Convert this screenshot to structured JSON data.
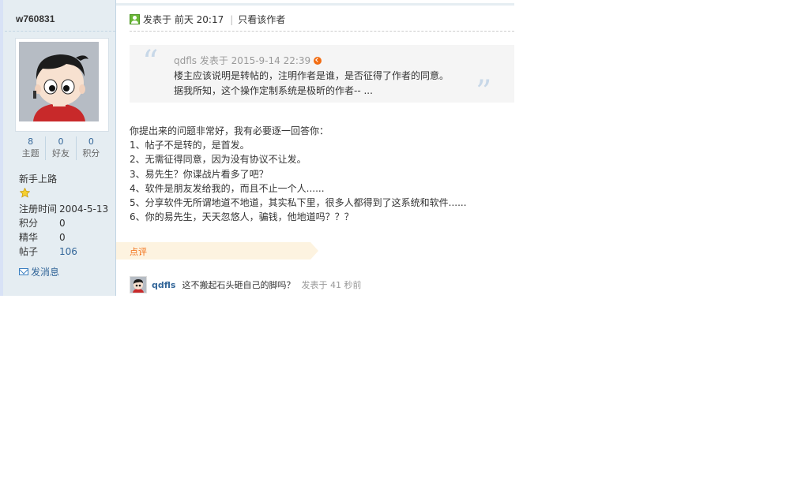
{
  "user": {
    "username": "w760831",
    "stats": [
      {
        "value": "8",
        "label": "主题"
      },
      {
        "value": "0",
        "label": "好友"
      },
      {
        "value": "0",
        "label": "积分"
      }
    ],
    "rank": "新手上路",
    "info": [
      {
        "key": "注册时间",
        "value": "2004-5-13"
      },
      {
        "key": "积分",
        "value": "0"
      },
      {
        "key": "精华",
        "value": "0"
      },
      {
        "key": "帖子",
        "value": "106"
      }
    ],
    "message_link": "发消息"
  },
  "post": {
    "posted_label": "发表于 前天 20:17",
    "only_author": "只看该作者",
    "quote": {
      "open_mark": "“",
      "close_mark": "”",
      "header": "qdfls 发表于 2015-9-14 22:39",
      "lines": [
        "楼主应该说明是转帖的，注明作者是谁，是否征得了作者的同意。",
        "据我所知，这个操作定制系统是极昕的作者-- ..."
      ]
    },
    "body_lines": [
      "你提出来的问题非常好，我有必要逐一回答你：",
      "1、帖子不是转的，是首发。",
      "2、无需征得同意，因为没有协议不让发。",
      "3、易先生？你谍战片看多了吧？",
      "4、软件是朋友发给我的，而且不止一个人......",
      "5、分享软件无所谓地道不地道，其实私下里，很多人都得到了这系统和软件......",
      "6、你的易先生，天天忽悠人，骗钱，他地道吗？？？"
    ]
  },
  "review": {
    "label": "点评",
    "comment": {
      "author": "qdfls",
      "text": "这不搬起石头砸自己的脚吗？",
      "time": "发表于 41 秒前"
    }
  },
  "colors": {
    "sidebar_bg": "#e5edf2",
    "link": "#336699",
    "accent_orange": "#f26c12"
  }
}
